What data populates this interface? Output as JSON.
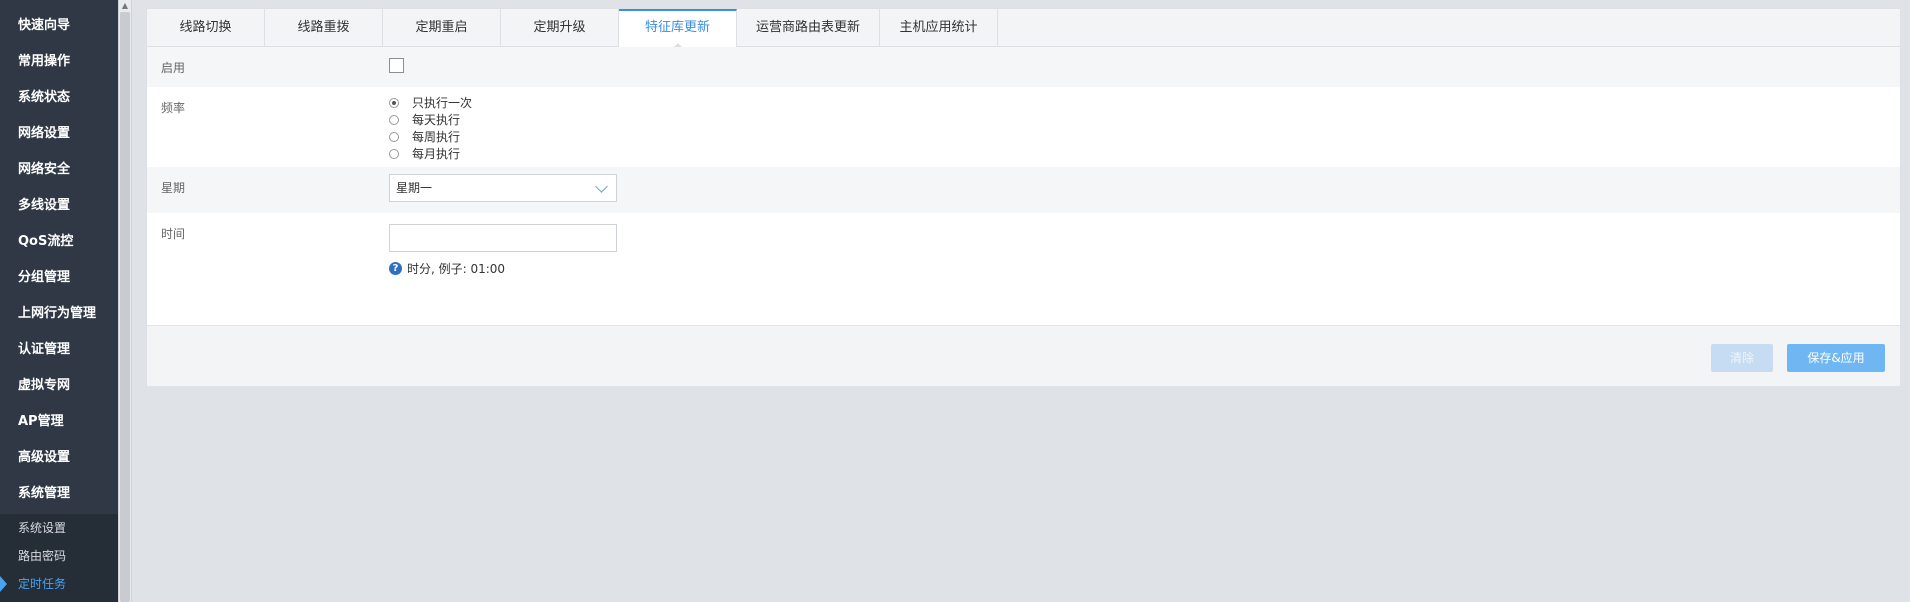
{
  "sidebar": {
    "items": [
      {
        "label": "快速向导"
      },
      {
        "label": "常用操作"
      },
      {
        "label": "系统状态"
      },
      {
        "label": "网络设置"
      },
      {
        "label": "网络安全"
      },
      {
        "label": "多线设置"
      },
      {
        "label": "QoS流控"
      },
      {
        "label": "分组管理"
      },
      {
        "label": "上网行为管理"
      },
      {
        "label": "认证管理"
      },
      {
        "label": "虚拟专网"
      },
      {
        "label": "AP管理"
      },
      {
        "label": "高级设置"
      },
      {
        "label": "系统管理"
      }
    ],
    "subitems": [
      {
        "label": "系统设置"
      },
      {
        "label": "路由密码"
      },
      {
        "label": "定时任务"
      }
    ]
  },
  "tabs": [
    {
      "label": "线路切换"
    },
    {
      "label": "线路重拨"
    },
    {
      "label": "定期重启"
    },
    {
      "label": "定期升级"
    },
    {
      "label": "特征库更新"
    },
    {
      "label": "运营商路由表更新"
    },
    {
      "label": "主机应用统计"
    }
  ],
  "form": {
    "enable_label": "启用",
    "frequency_label": "频率",
    "frequency_options": [
      {
        "label": "只执行一次"
      },
      {
        "label": "每天执行"
      },
      {
        "label": "每周执行"
      },
      {
        "label": "每月执行"
      }
    ],
    "week_label": "星期",
    "week_value": "星期一",
    "time_label": "时间",
    "time_value": "",
    "time_hint": "时分, 例子: 01:00"
  },
  "buttons": {
    "clear": "清除",
    "save": "保存&应用"
  },
  "colors": {
    "sidebar_bg": "#2f3844",
    "accent": "#3a8ee6",
    "save_button": "#6fb7f2",
    "clear_button": "#c6dcf2"
  }
}
